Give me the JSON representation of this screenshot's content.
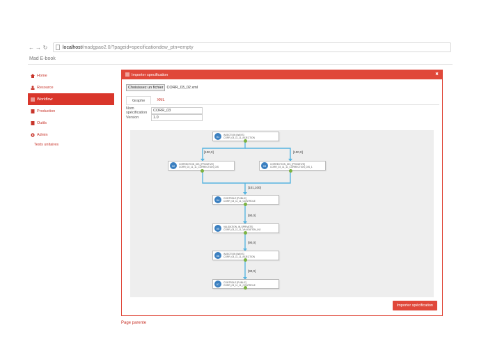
{
  "browser": {
    "url_host": "localhost",
    "url_path": "/madgpao2.0/?pageid=specificationdew_ptn=empty"
  },
  "app": {
    "title": "Mad E-book"
  },
  "sidebar": {
    "items": [
      {
        "label": "Home"
      },
      {
        "label": "Resource"
      },
      {
        "label": "Workflow"
      },
      {
        "label": "Production"
      },
      {
        "label": "Outils"
      },
      {
        "label": "Admin"
      }
    ],
    "sub_items": [
      {
        "label": "Tests unitaires"
      }
    ]
  },
  "panel": {
    "title": "Importer specification",
    "file_button": "Choisissez un fichier",
    "file_name": "CORR_03_02.xml",
    "tabs": [
      {
        "label": "Graphe"
      },
      {
        "label": "XML"
      }
    ],
    "spec_label": "Nom spécification",
    "spec_value": "CORR_03",
    "version_label": "Version",
    "version_value": "1.0",
    "import_button": "Importer spécification"
  },
  "graph": {
    "nodes": [
      {
        "badge": "01",
        "line1": "INJECTION [WAYS]",
        "line2": "CORR_03_11_11_INJECTION"
      },
      {
        "badge": "02",
        "line1": "CORRECTION_DIS_[PRIVATIVE]",
        "line2": "CORR_03_11_11_CORRECTION_DIS"
      },
      {
        "badge": "03",
        "line1": "CORRECTION_DIS_[PRIVATIVE]",
        "line2": "CORR_03_11_11_CORRECTION_DIS_1"
      },
      {
        "badge": "04",
        "line1": "CONTROLE [PUBLIC]",
        "line2": "CORR_03_11_11_CONTROLE"
      },
      {
        "badge": "05",
        "line1": "VALIDATION_INJ [PRIVATE]",
        "line2": "CORR_03_11_11_VALIDATION_INJ"
      },
      {
        "badge": "06",
        "line1": "INJECTION [WAYS]",
        "line2": "CORR_03_11_11_INJECTION"
      },
      {
        "badge": "07",
        "line1": "CONTROLE [PUBLIC]",
        "line2": "CORR_03_11_11_CONTROLE"
      }
    ],
    "edge_labels": [
      "[100,0]",
      "[100,0]",
      "[101,100]",
      "[90,0]",
      "[90,0]",
      "[90,0]"
    ]
  },
  "footer": {
    "link": "Page parente"
  },
  "colors": {
    "accent": "#e0483a",
    "node_badge": "#3a7fc0",
    "edge": "#57b4e0",
    "port": "#7cb342"
  }
}
